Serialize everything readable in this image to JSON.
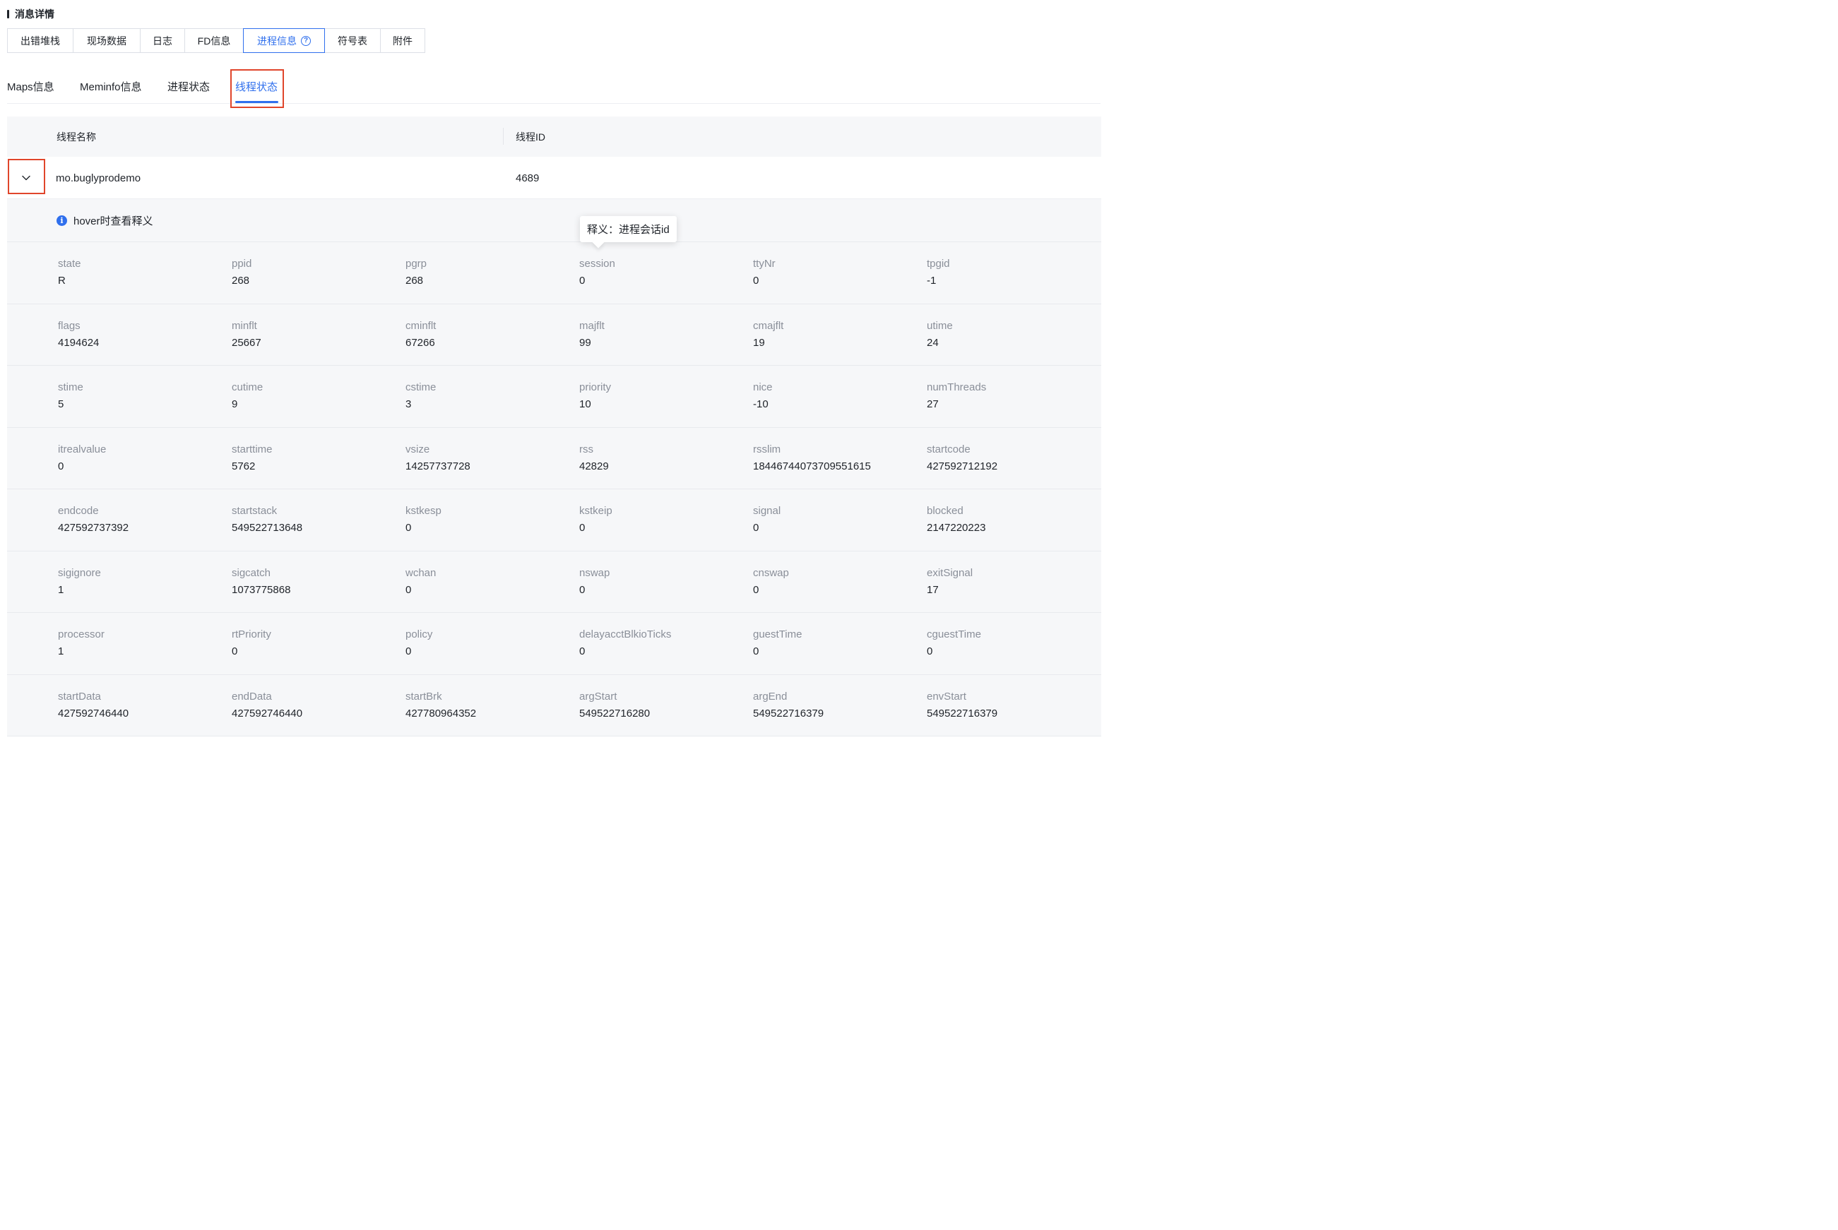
{
  "section_title": "消息详情",
  "primary_tabs": [
    {
      "label": "出错堆栈",
      "active": false
    },
    {
      "label": "现场数据",
      "active": false
    },
    {
      "label": "日志",
      "active": false
    },
    {
      "label": "FD信息",
      "active": false
    },
    {
      "label": "进程信息",
      "active": true,
      "icon": "help-circle-icon"
    },
    {
      "label": "符号表",
      "active": false
    },
    {
      "label": "附件",
      "active": false
    }
  ],
  "secondary_tabs": [
    {
      "label": "Maps信息",
      "active": false
    },
    {
      "label": "Meminfo信息",
      "active": false
    },
    {
      "label": "进程状态",
      "active": false
    },
    {
      "label": "线程状态",
      "active": true
    }
  ],
  "table": {
    "columns": [
      "线程名称",
      "线程ID"
    ],
    "rows": [
      {
        "name": "mo.buglyprodemo",
        "id": "4689",
        "expanded": true
      }
    ]
  },
  "hint": {
    "icon": "info-icon",
    "text": "hover时查看释义"
  },
  "tooltip": {
    "text": "释义：进程会话id"
  },
  "fields": [
    [
      {
        "label": "state",
        "value": "R"
      },
      {
        "label": "ppid",
        "value": "268"
      },
      {
        "label": "pgrp",
        "value": "268"
      },
      {
        "label": "session",
        "value": "0"
      },
      {
        "label": "ttyNr",
        "value": "0"
      },
      {
        "label": "tpgid",
        "value": "-1"
      }
    ],
    [
      {
        "label": "flags",
        "value": "4194624"
      },
      {
        "label": "minflt",
        "value": "25667"
      },
      {
        "label": "cminflt",
        "value": "67266"
      },
      {
        "label": "majflt",
        "value": "99"
      },
      {
        "label": "cmajflt",
        "value": "19"
      },
      {
        "label": "utime",
        "value": "24"
      }
    ],
    [
      {
        "label": "stime",
        "value": "5"
      },
      {
        "label": "cutime",
        "value": "9"
      },
      {
        "label": "cstime",
        "value": "3"
      },
      {
        "label": "priority",
        "value": "10"
      },
      {
        "label": "nice",
        "value": "-10"
      },
      {
        "label": "numThreads",
        "value": "27"
      }
    ],
    [
      {
        "label": "itrealvalue",
        "value": "0"
      },
      {
        "label": "starttime",
        "value": "5762"
      },
      {
        "label": "vsize",
        "value": "14257737728"
      },
      {
        "label": "rss",
        "value": "42829"
      },
      {
        "label": "rsslim",
        "value": "18446744073709551615"
      },
      {
        "label": "startcode",
        "value": "427592712192"
      }
    ],
    [
      {
        "label": "endcode",
        "value": "427592737392"
      },
      {
        "label": "startstack",
        "value": "549522713648"
      },
      {
        "label": "kstkesp",
        "value": "0"
      },
      {
        "label": "kstkeip",
        "value": "0"
      },
      {
        "label": "signal",
        "value": "0"
      },
      {
        "label": "blocked",
        "value": "2147220223"
      }
    ],
    [
      {
        "label": "sigignore",
        "value": "1"
      },
      {
        "label": "sigcatch",
        "value": "1073775868"
      },
      {
        "label": "wchan",
        "value": "0"
      },
      {
        "label": "nswap",
        "value": "0"
      },
      {
        "label": "cnswap",
        "value": "0"
      },
      {
        "label": "exitSignal",
        "value": "17"
      }
    ],
    [
      {
        "label": "processor",
        "value": "1"
      },
      {
        "label": "rtPriority",
        "value": "0"
      },
      {
        "label": "policy",
        "value": "0"
      },
      {
        "label": "delayacctBlkioTicks",
        "value": "0"
      },
      {
        "label": "guestTime",
        "value": "0"
      },
      {
        "label": "cguestTime",
        "value": "0"
      }
    ],
    [
      {
        "label": "startData",
        "value": "427592746440"
      },
      {
        "label": "endData",
        "value": "427592746440"
      },
      {
        "label": "startBrk",
        "value": "427780964352"
      },
      {
        "label": "argStart",
        "value": "549522716280"
      },
      {
        "label": "argEnd",
        "value": "549522716379"
      },
      {
        "label": "envStart",
        "value": "549522716379"
      }
    ]
  ],
  "colors": {
    "accent": "#2f6fed",
    "highlight": "#e0452b",
    "muted_label": "#8a8f99"
  }
}
